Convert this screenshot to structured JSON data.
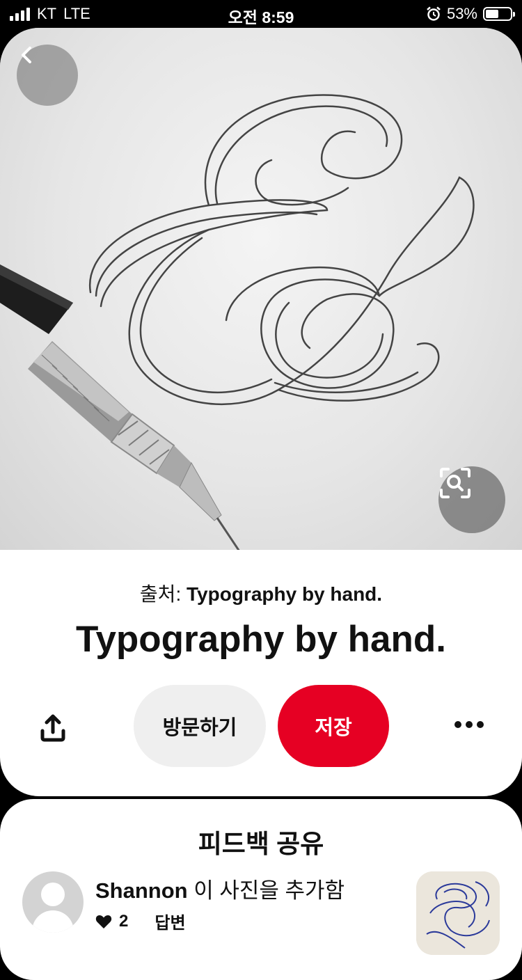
{
  "status_bar": {
    "carrier": "KT",
    "network": "LTE",
    "time": "오전 8:59",
    "battery_percent": "53%",
    "battery_level": 0.53
  },
  "pin": {
    "source_prefix": "출처:",
    "source_name": "Typography by hand.",
    "title": "Typography by hand.",
    "buttons": {
      "visit": "방문하기",
      "save": "저장"
    },
    "icons": {
      "back": "chevron-left-icon",
      "lens": "visual-search-icon",
      "share": "share-upload-icon",
      "more": "more-dots-icon"
    },
    "colors": {
      "save_bg": "#e60023",
      "visit_bg": "#efefef"
    }
  },
  "feedback": {
    "title": "피드백 공유",
    "user": "Shannon",
    "action_text": "이 사진을 추가함",
    "likes": "2",
    "reply_label": "답변"
  }
}
